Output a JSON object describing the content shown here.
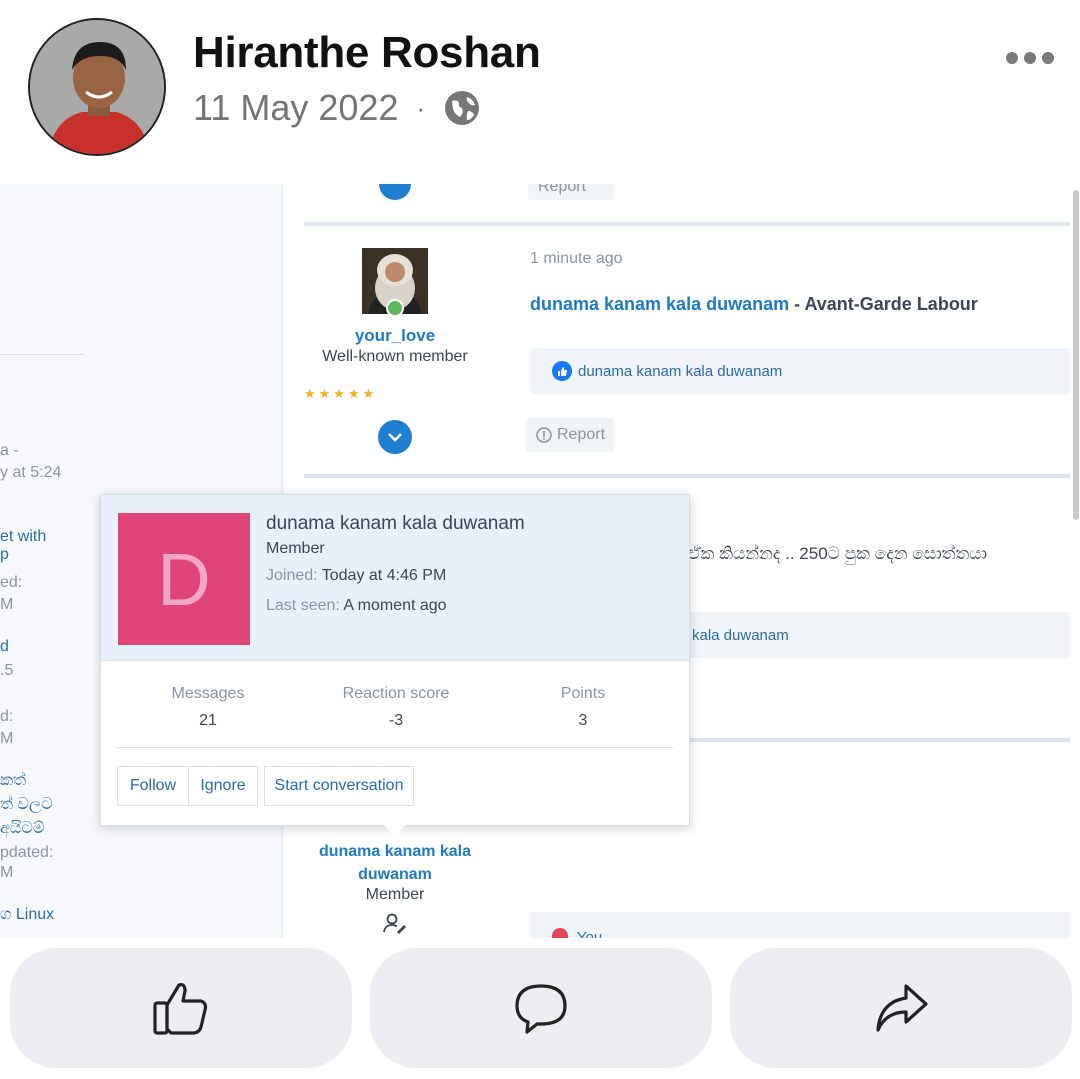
{
  "post": {
    "author": "Hiranthe Roshan",
    "date": "11 May 2022",
    "separator": "·",
    "privacy_icon": "globe-icon",
    "menu_icon": "more-options-icon"
  },
  "forum": {
    "left_fragments": [
      "a -",
      "y at 5:24",
      "et with",
      "p",
      "ed:",
      "M",
      "d",
      ".5",
      "d:",
      "M",
      "කත්",
      "ත් වලට",
      "අයිටම්",
      "pdated:",
      "M",
      "ග Linux"
    ],
    "top_report": "Report",
    "post1": {
      "username": "your_love",
      "user_title": "Well-known member",
      "rating": "★★★★★",
      "time_ago": "1 minute ago",
      "thread_user": "dunama kanam kala duwanam",
      "thread_sep": "-",
      "thread_title": "Avant-Garde Labour",
      "liked_by": "dunama kanam kala duwanam",
      "report": "Report"
    },
    "post2": {
      "text_fragment": "ඒක කියන්නද .. 250ට පුක දෙන සොත්තයා",
      "liked_by_fragment": "kala duwanam"
    },
    "post3": {
      "username_line1": "dunama kanam kala",
      "username_line2": "duwanam",
      "user_title": "Member",
      "reaction_fragment": "You"
    }
  },
  "popover": {
    "avatar_letter": "D",
    "avatar_color": "#e0457a",
    "name": "dunama kanam kala duwanam",
    "role": "Member",
    "joined_label": "Joined:",
    "joined_value": "Today at 4:46 PM",
    "last_seen_label": "Last seen:",
    "last_seen_value": "A moment ago",
    "stats": [
      {
        "label": "Messages",
        "value": "21"
      },
      {
        "label": "Reaction score",
        "value": "-3"
      },
      {
        "label": "Points",
        "value": "3"
      }
    ],
    "buttons": {
      "follow": "Follow",
      "ignore": "Ignore",
      "start_conversation": "Start conversation"
    }
  },
  "actions": {
    "like_icon": "thumbs-up-icon",
    "comment_icon": "comment-icon",
    "share_icon": "share-icon"
  },
  "colors": {
    "link": "#1f7ac3",
    "accent": "#1c7fd0",
    "button_bg": "#eceef1"
  }
}
